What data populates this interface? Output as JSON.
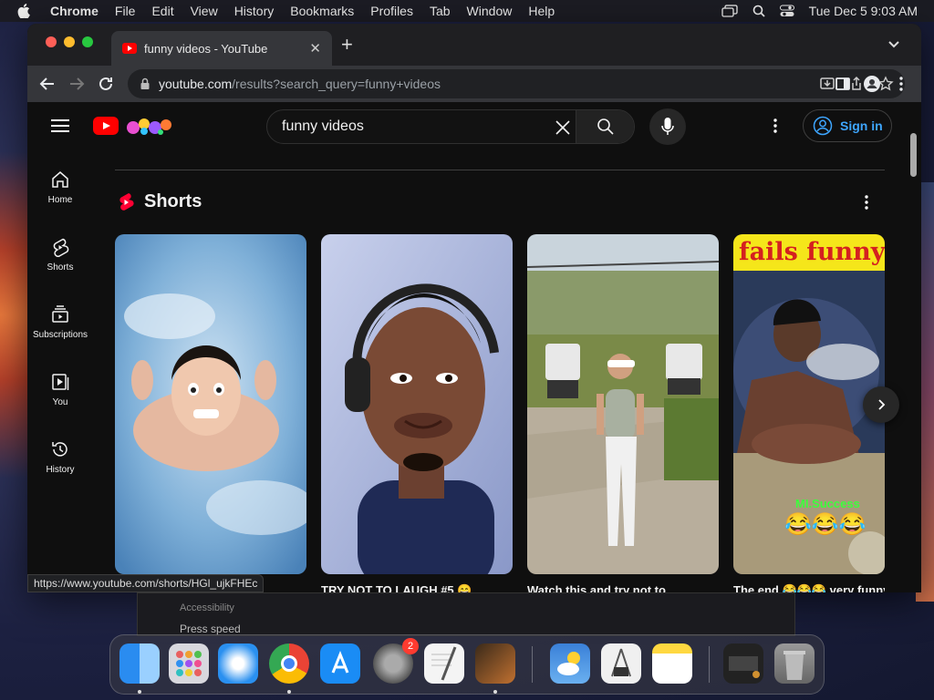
{
  "menubar": {
    "app": "Chrome",
    "items": [
      "File",
      "Edit",
      "View",
      "History",
      "Bookmarks",
      "Profiles",
      "Tab",
      "Window",
      "Help"
    ],
    "clock": "Tue Dec 5  9:03 AM"
  },
  "browser": {
    "tab_title": "funny videos - YouTube",
    "url_host": "youtube.com",
    "url_path": "/results?search_query=funny+videos",
    "status_url": "https://www.youtube.com/shorts/HGl_ujkFHEc"
  },
  "youtube": {
    "search_value": "funny videos",
    "sign_in": "Sign in",
    "sidebar": [
      {
        "label": "Home",
        "icon": "home-icon"
      },
      {
        "label": "Shorts",
        "icon": "shorts-icon"
      },
      {
        "label": "Subscriptions",
        "icon": "subscriptions-icon"
      },
      {
        "label": "You",
        "icon": "you-icon"
      },
      {
        "label": "History",
        "icon": "history-icon"
      }
    ],
    "shorts_heading": "Shorts",
    "shorts": [
      {
        "title": ""
      },
      {
        "title": "TRY NOT TO LAUGH #5 😄"
      },
      {
        "title": "Watch this and try not to"
      },
      {
        "title": "The end 😂😂😂 very funny",
        "overlay_top": "fails funny",
        "overlay_bottom": "MI.Success"
      }
    ]
  },
  "background_window": {
    "line1": "Accessibility",
    "line2": "Press speed"
  },
  "dock": {
    "apps": [
      "Finder",
      "Launchpad",
      "Safari",
      "Chrome",
      "App Store",
      "System Settings",
      "TextEdit",
      "GarageBand",
      "Weather",
      "Simulator",
      "Notes",
      "Preview",
      "Trash"
    ],
    "settings_badge": "2"
  },
  "colors": {
    "yt_red": "#ff0000",
    "link_blue": "#3ea6ff",
    "bg": "#0f0f0f"
  }
}
